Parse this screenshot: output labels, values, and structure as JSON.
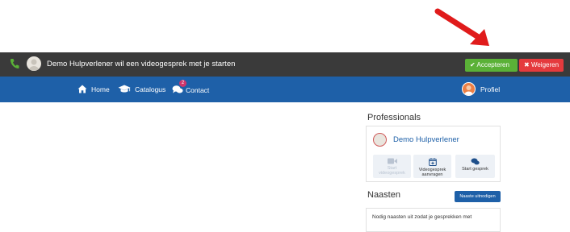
{
  "annotation": {
    "arrow_color": "#e01b1b"
  },
  "callbar": {
    "message": "Demo Hulpverlener wil een videogesprek met je starten",
    "accept_label": "Accepteren",
    "decline_label": "Weigeren",
    "accept_color": "#5ab137",
    "decline_color": "#e53a3d"
  },
  "nav": {
    "items": [
      {
        "label": "Home",
        "icon": "home-icon"
      },
      {
        "label": "Catalogus",
        "icon": "graduation-cap-icon"
      },
      {
        "label": "Contact",
        "icon": "chat-bubbles-icon",
        "badge": "2"
      }
    ],
    "profile_label": "Profiel",
    "brand_color": "#1e60a8"
  },
  "professionals": {
    "title": "Professionals",
    "contact_name": "Demo Hulpverlener",
    "actions": [
      {
        "label_line1": "Start",
        "label_line2": "videogesprek",
        "icon": "video-camera-icon",
        "disabled": true
      },
      {
        "label_line1": "Videogesprek",
        "label_line2": "aanvragen",
        "icon": "calendar-plus-icon",
        "disabled": false
      },
      {
        "label_line1": "Start gesprek",
        "label_line2": "",
        "icon": "chat-icon",
        "disabled": false
      }
    ]
  },
  "naasten": {
    "title": "Naasten",
    "invite_button": "Naaste uitnodigen",
    "invite_text": "Nodig naasten uit zodat je gesprekken met"
  }
}
